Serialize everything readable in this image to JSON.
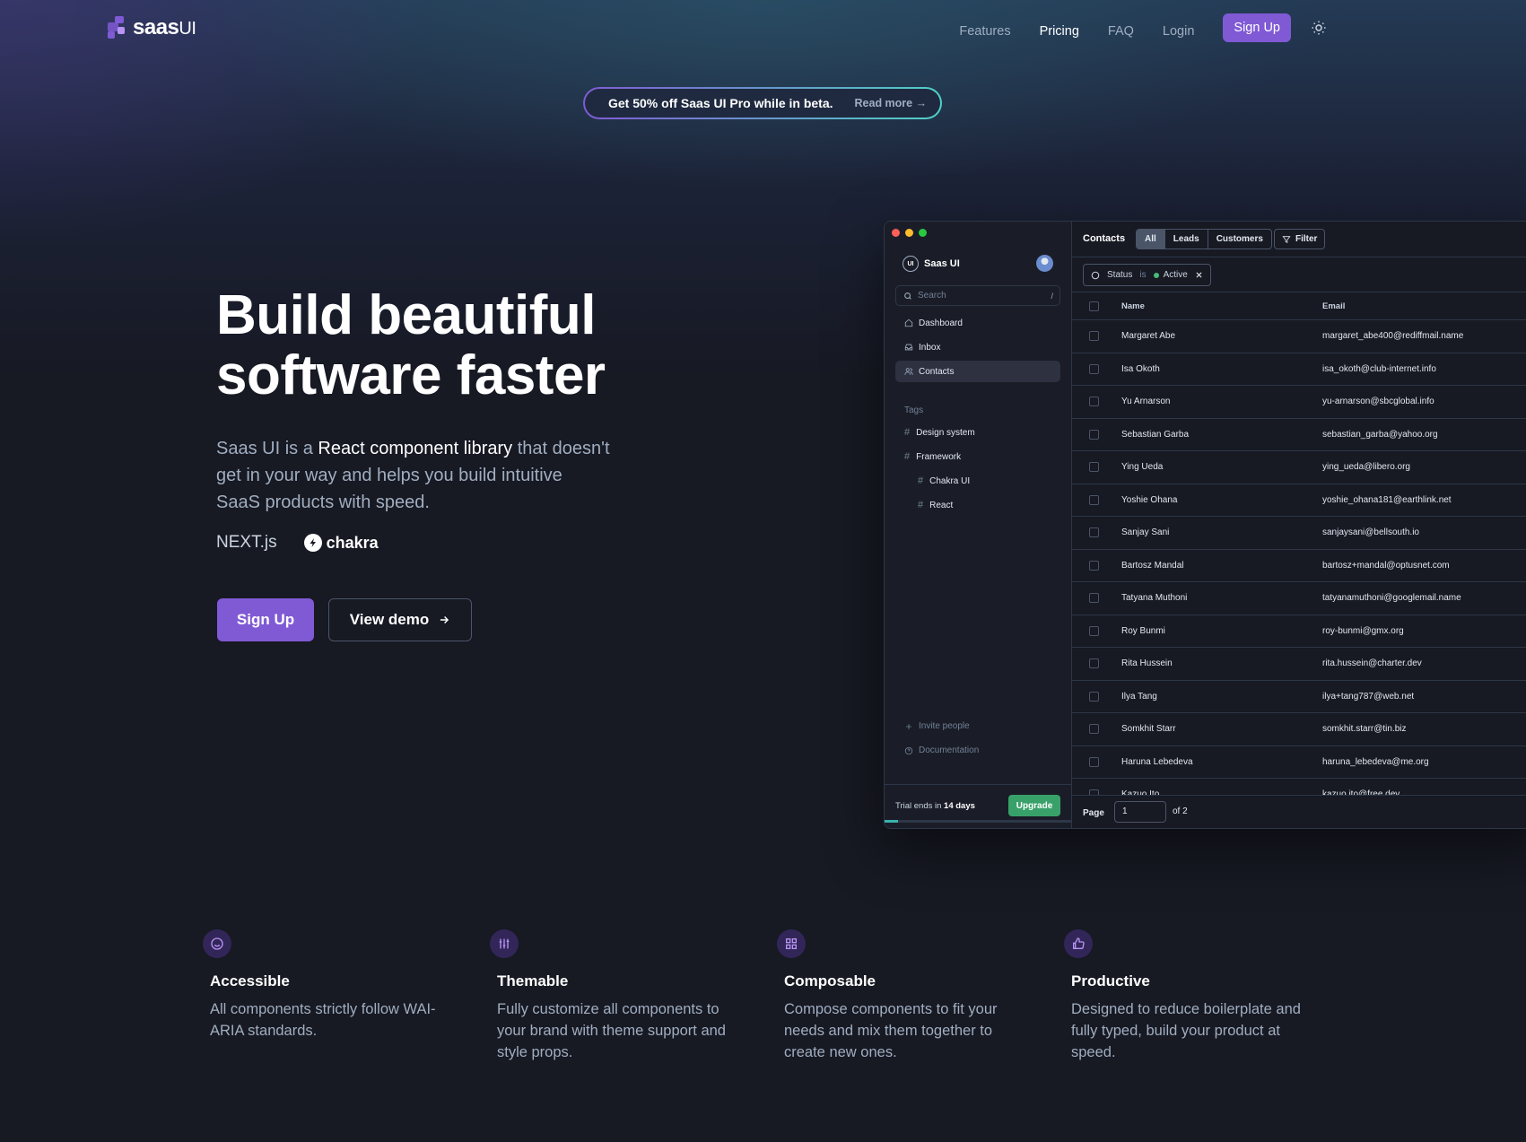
{
  "nav": {
    "logo_main": "saas",
    "logo_suffix": "UI",
    "links": [
      "Features",
      "Pricing",
      "FAQ",
      "Login"
    ],
    "active_link": "Pricing",
    "signup": "Sign Up"
  },
  "banner": {
    "text": "Get 50% off Saas UI Pro while in beta.",
    "link": "Read more →"
  },
  "hero": {
    "title_line1": "Build beautiful",
    "title_line2": "software faster",
    "desc_prefix": "Saas UI is a ",
    "desc_highlight": "React component library",
    "desc_rest": " that doesn't get in your way and helps you build intuitive SaaS products with speed.",
    "brand_next": "NEXT.js",
    "brand_chakra": "chakra",
    "signup": "Sign Up",
    "demo": "View demo"
  },
  "app": {
    "brand": "Saas UI",
    "brand_icon": "UI",
    "search_placeholder": "Search",
    "search_kbd": "/",
    "nav": [
      "Dashboard",
      "Inbox",
      "Contacts"
    ],
    "active_nav": "Contacts",
    "tags_label": "Tags",
    "tags": [
      "Design system",
      "Framework"
    ],
    "subtags": [
      "Chakra UI",
      "React"
    ],
    "bottom": [
      "Invite people",
      "Documentation"
    ],
    "trial_prefix": "Trial ends in ",
    "trial_days": "14 days",
    "upgrade": "Upgrade",
    "trial_progress": 0.07,
    "toolbar_title": "Contacts",
    "segments": [
      "All",
      "Leads",
      "Customers"
    ],
    "active_segment": "All",
    "filter": "Filter",
    "filter_status_label": "Status",
    "filter_is": "is",
    "filter_value": "Active",
    "columns": [
      "Name",
      "Email"
    ],
    "rows": [
      {
        "name": "Margaret Abe",
        "email": "margaret_abe400@rediffmail.name"
      },
      {
        "name": "Isa Okoth",
        "email": "isa_okoth@club-internet.info"
      },
      {
        "name": "Yu Arnarson",
        "email": "yu-arnarson@sbcglobal.info"
      },
      {
        "name": "Sebastian Garba",
        "email": "sebastian_garba@yahoo.org"
      },
      {
        "name": "Ying Ueda",
        "email": "ying_ueda@libero.org"
      },
      {
        "name": "Yoshie Ohana",
        "email": "yoshie_ohana181@earthlink.net"
      },
      {
        "name": "Sanjay Sani",
        "email": "sanjaysani@bellsouth.io"
      },
      {
        "name": "Bartosz Mandal",
        "email": "bartosz+mandal@optusnet.com"
      },
      {
        "name": "Tatyana Muthoni",
        "email": "tatyanamuthoni@googlemail.name"
      },
      {
        "name": "Roy Bunmi",
        "email": "roy-bunmi@gmx.org"
      },
      {
        "name": "Rita Hussein",
        "email": "rita.hussein@charter.dev"
      },
      {
        "name": "Ilya Tang",
        "email": "ilya+tang787@web.net"
      },
      {
        "name": "Somkhit Starr",
        "email": "somkhit.starr@tin.biz"
      },
      {
        "name": "Haruna Lebedeva",
        "email": "haruna_lebedeva@me.org"
      },
      {
        "name": "Kazuo Ito",
        "email": "kazuo.ito@free.dev"
      }
    ],
    "page_label": "Page",
    "page_value": "1",
    "page_of": "of 2"
  },
  "features": [
    {
      "icon": "smiley-icon",
      "title": "Accessible",
      "desc": "All components strictly follow WAI-ARIA standards."
    },
    {
      "icon": "sliders-icon",
      "title": "Themable",
      "desc": "Fully customize all components to your brand with theme support and style props."
    },
    {
      "icon": "grid-icon",
      "title": "Composable",
      "desc": "Compose components to fit your needs and mix them together to create new ones."
    },
    {
      "icon": "thumbs-up-icon",
      "title": "Productive",
      "desc": "Designed to reduce boilerplate and fully typed, build your product at speed."
    }
  ],
  "colors": {
    "accent": "#805ad5",
    "upgrade": "#38a169",
    "background": "#171923"
  }
}
